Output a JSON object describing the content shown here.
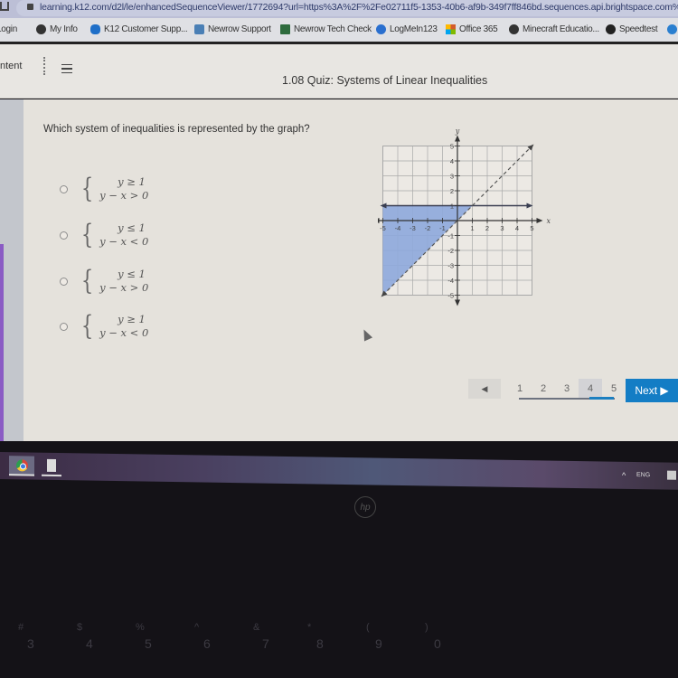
{
  "browser": {
    "url": "learning.k12.com/d2l/le/enhancedSequenceViewer/1772694?url=https%3A%2F%2Fe02711f5-1353-40b6-af9b-349f7ff846bd.sequences.api.brightspace.com%",
    "bookmarks": [
      {
        "label": "Login",
        "icon": "bookmark-icon",
        "color": "#3a6fb0"
      },
      {
        "label": "My Info",
        "icon": "globe-icon",
        "color": "#333333"
      },
      {
        "label": "K12 Customer Supp...",
        "icon": "salesforce-cloud-icon",
        "color": "#1f6fc8"
      },
      {
        "label": "Newrow Support",
        "icon": "newrow-icon",
        "color": "#4a7fb5"
      },
      {
        "label": "Newrow Tech Check",
        "icon": "newrow-check-icon",
        "color": "#2e6b3d"
      },
      {
        "label": "LogMeIn123",
        "icon": "logmein-icon",
        "color": "#2a6fcf"
      },
      {
        "label": "Office 365",
        "icon": "office-icon",
        "color": "#d35b2a"
      },
      {
        "label": "Minecraft Educatio...",
        "icon": "globe-icon",
        "color": "#333333"
      },
      {
        "label": "Speedtest",
        "icon": "speedtest-icon",
        "color": "#222222"
      }
    ]
  },
  "header": {
    "content_link": "ntent",
    "quiz_title": "1.08 Quiz: Systems of Linear Inequalities"
  },
  "question": {
    "prompt": "Which system of inequalities is represented by the graph?",
    "options": [
      {
        "line1": "y ≥ 1",
        "line2": "y − x > 0"
      },
      {
        "line1": "y ≤ 1",
        "line2": "y − x < 0"
      },
      {
        "line1": "y ≤ 1",
        "line2": "y − x > 0"
      },
      {
        "line1": "y ≥ 1",
        "line2": "y − x < 0"
      }
    ]
  },
  "graph": {
    "x_label": "x",
    "y_label": "y",
    "range": [
      -5,
      5
    ],
    "x_ticks": [
      "-5",
      "-4",
      "-3",
      "-2",
      "-1",
      "1",
      "2",
      "3",
      "4",
      "5"
    ],
    "y_ticks": [
      "5",
      "4",
      "3",
      "2",
      "1",
      "-1",
      "-2",
      "-3",
      "-4",
      "-5"
    ],
    "lines": [
      {
        "equation": "y = 1",
        "style": "solid"
      },
      {
        "equation": "y = x",
        "style": "dashed"
      }
    ],
    "shaded_region": "y ≤ 1 and y > x",
    "shade_color": "#8ea8dc"
  },
  "pagination": {
    "prev_label": "◀",
    "pages": [
      "1",
      "2",
      "3",
      "4",
      "5"
    ],
    "current_page": "4",
    "next_label": "Next ▶",
    "accent": "#137dc5"
  },
  "taskbar": {
    "tray_label": "^ ⌨",
    "kb_label": "ENG"
  },
  "laptop": {
    "logo": "hp",
    "keys": [
      "#",
      "$",
      "%",
      "^",
      "&",
      "*",
      "(",
      ")",
      "3",
      "4",
      "5",
      "6",
      "7",
      "8",
      "9",
      "0"
    ]
  }
}
